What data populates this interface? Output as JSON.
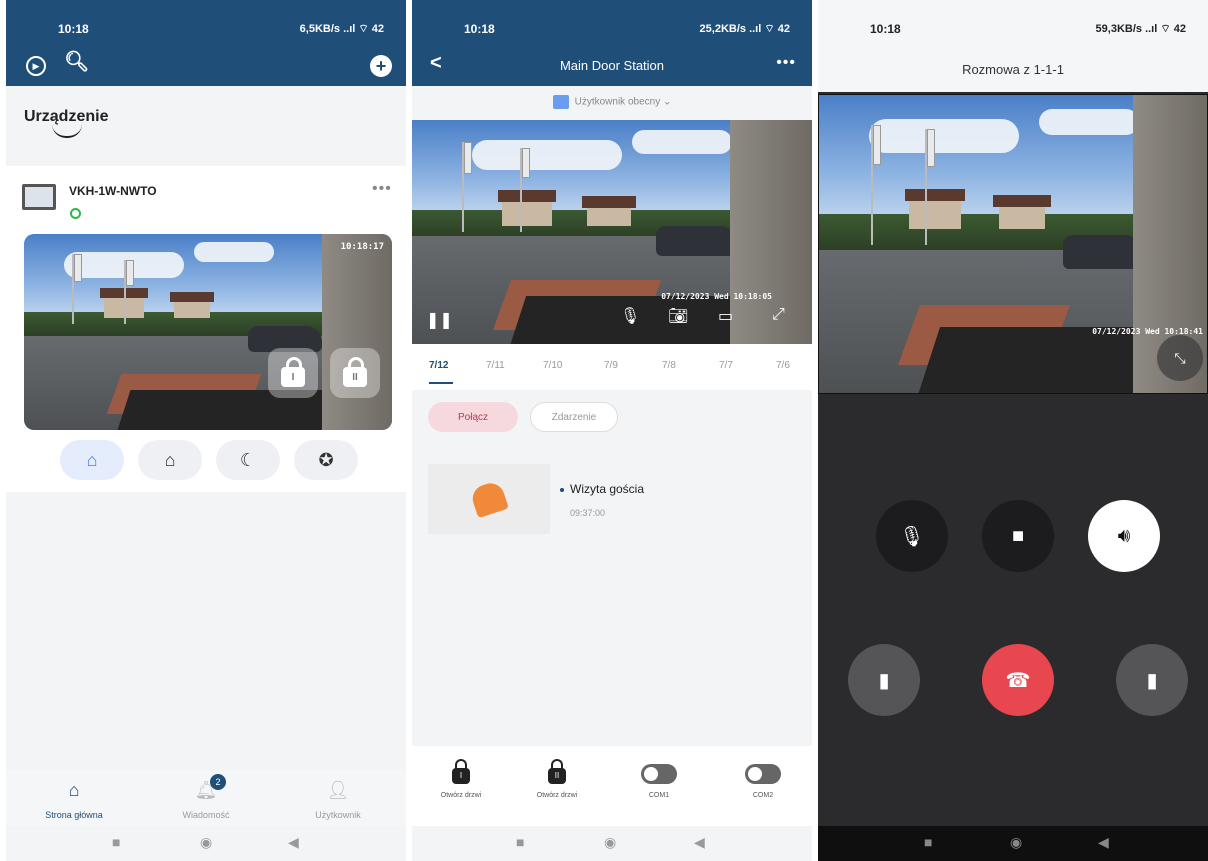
{
  "panel1": {
    "status": {
      "time": "10:18",
      "net": "6,5KB/s ..ıl ⌔ 42"
    },
    "title": "Urządzenie",
    "device": {
      "name": "VKH-1W-NWTO",
      "timestamp": "10:18:17"
    },
    "locks": [
      "I",
      "II"
    ],
    "tabs": [
      {
        "label": "Strona główna"
      },
      {
        "label": "Wiadomość",
        "badge": "2"
      },
      {
        "label": "Użytkownik"
      }
    ]
  },
  "panel2": {
    "status": {
      "time": "10:18",
      "net": "25,2KB/s ..ıl ⌔ 42"
    },
    "title": "Main Door Station",
    "user_select": "Użytkownik obecny",
    "stamp": "07/12/2023 Wed 10:18:05",
    "dates": [
      "7/12",
      "7/11",
      "7/10",
      "7/9",
      "7/8",
      "7/7",
      "7/6"
    ],
    "filters": [
      "Połącz",
      "Zdarzenie"
    ],
    "event": {
      "title": "Wizyta gościa",
      "time": "09:37:00"
    },
    "bottom": [
      {
        "label": "Otwórz drzwi",
        "mark": "I"
      },
      {
        "label": "Otwórz drzwi",
        "mark": "II"
      },
      {
        "label": "COM1"
      },
      {
        "label": "COM2"
      }
    ]
  },
  "panel3": {
    "status": {
      "time": "10:18",
      "net": "59,3KB/s ..ıl ⌔ 42"
    },
    "title": "Rozmowa z 1-1-1",
    "stamp": "07/12/2023 Wed 10:18:41"
  },
  "colors": {
    "primary": "#1f4e79",
    "hangup": "#e9474f",
    "accent": "#4a7ee8"
  }
}
